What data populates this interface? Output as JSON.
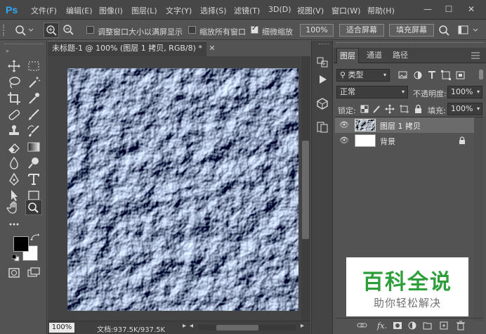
{
  "app": {
    "logo": "Ps",
    "accent": "#31a8ff"
  },
  "menu": [
    "文件(F)",
    "编辑(E)",
    "图像(I)",
    "图层(L)",
    "文字(Y)",
    "选择(S)",
    "滤镜(T)",
    "3D(D)",
    "视图(V)",
    "窗口(W)",
    "帮助(H)"
  ],
  "window_controls": [
    "—",
    "☐",
    "✕"
  ],
  "options": {
    "resize_windows_label": "调整窗口大小以满屏显示",
    "zoom_all_label": "缩放所有窗口",
    "scrubby_zoom_label": "细微缩放",
    "zoom_value": "100%",
    "fit_screen": "适合屏幕",
    "fill_screen": "填充屏幕",
    "resize_windows_checked": false,
    "zoom_all_checked": false,
    "scrubby_checked": true
  },
  "document": {
    "tab_title": "未标题-1 @ 100% (图层 1 拷贝, RGB/8) *",
    "close": "✕",
    "status_zoom": "100%",
    "status_info": "文档:937.5K/937.5K"
  },
  "panel": {
    "tabs": [
      "图层",
      "通道",
      "路径"
    ],
    "filter_kind": "类型",
    "blend_mode": "正常",
    "opacity_label": "不透明度:",
    "opacity_value": "100%",
    "lock_label": "锁定:",
    "fill_label": "填充:",
    "fill_value": "100%",
    "layers": [
      {
        "name": "图层 1 拷贝",
        "selected": true
      },
      {
        "name": "背景",
        "selected": false,
        "locked": true
      }
    ],
    "bottom_icons": [
      "link-icon",
      "fx-icon",
      "mask-icon",
      "adjustment-icon",
      "group-icon",
      "new-layer-icon",
      "trash-icon"
    ]
  },
  "watermark": {
    "title": "百科全说",
    "subtitle": "助你轻松解决",
    "color": "#2e9e3b"
  }
}
